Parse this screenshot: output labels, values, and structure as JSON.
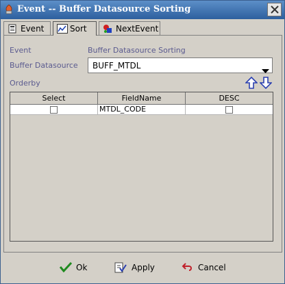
{
  "window": {
    "title": "Event -- Buffer Datasource Sorting"
  },
  "tabs": [
    {
      "label": "Event"
    },
    {
      "label": "Sort"
    },
    {
      "label": "NextEvent"
    }
  ],
  "form": {
    "event_label": "Event",
    "event_value": "Buffer Datasource Sorting",
    "buffer_label": "Buffer Datasource",
    "buffer_value": "BUFF_MTDL",
    "orderby_label": "Orderby"
  },
  "table": {
    "columns": [
      "Select",
      "FieldName",
      "DESC"
    ],
    "rows": [
      {
        "select": false,
        "fieldname": "MTDL_CODE",
        "desc": false
      }
    ]
  },
  "buttons": {
    "ok": "Ok",
    "apply": "Apply",
    "cancel": "Cancel"
  },
  "colors": {
    "titlebar": "#2d5f9e",
    "label_blue": "#5a5a8f",
    "ok_green": "#1f8a1f",
    "cancel_red": "#c0202a",
    "arrow_blue": "#2a3fb0"
  }
}
